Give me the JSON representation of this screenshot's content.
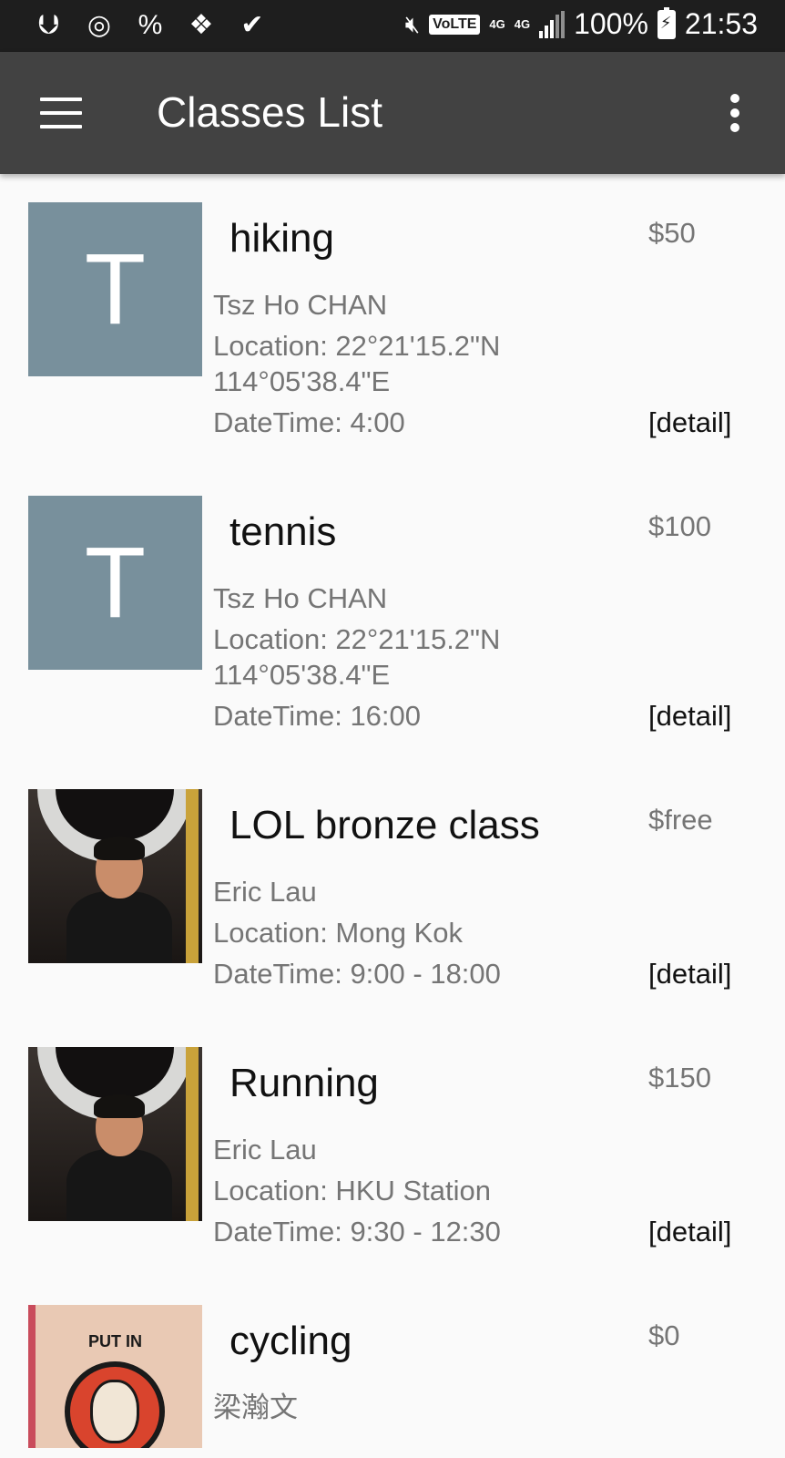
{
  "status_bar": {
    "left_icons": [
      "usb-icon",
      "incognito-icon",
      "percent-icon",
      "debug-icon",
      "check-app-icon"
    ],
    "mute_icon": "mute-icon",
    "volte": "VoLTE",
    "network_4g": "4G",
    "network_4g_small": "4G",
    "battery": "100%",
    "time": "21:53"
  },
  "app_bar": {
    "title": "Classes List",
    "menu_icon": "hamburger-menu-icon",
    "overflow_icon": "more-vert-icon"
  },
  "classes": [
    {
      "thumb_type": "letter",
      "thumb_letter": "T",
      "title": "hiking",
      "price": "$50",
      "instructor": "Tsz Ho CHAN",
      "location": "Location: 22°21'15.2\"N",
      "location_cont": "114°05'38.4\"E",
      "datetime": "DateTime: 4:00",
      "detail": "[detail]"
    },
    {
      "thumb_type": "letter",
      "thumb_letter": "T",
      "title": "tennis",
      "price": "$100",
      "instructor": "Tsz Ho CHAN",
      "location": "Location: 22°21'15.2\"N",
      "location_cont": "114°05'38.4\"E",
      "datetime": "DateTime: 16:00",
      "detail": "[detail]"
    },
    {
      "thumb_type": "photo",
      "title": "LOL bronze class",
      "price": "$free",
      "instructor": "Eric Lau",
      "location": "Location: Mong Kok",
      "datetime": "DateTime: 9:00 - 18:00",
      "detail": "[detail]"
    },
    {
      "thumb_type": "photo",
      "title": "Running",
      "price": "$150",
      "instructor": "Eric Lau",
      "location": "Location: HKU Station",
      "datetime": "DateTime: 9:30 - 12:30",
      "detail": "[detail]"
    },
    {
      "thumb_type": "stamp",
      "thumb_text": "PUT IN",
      "title": "cycling",
      "price": "$0",
      "instructor": "梁瀚文"
    }
  ]
}
